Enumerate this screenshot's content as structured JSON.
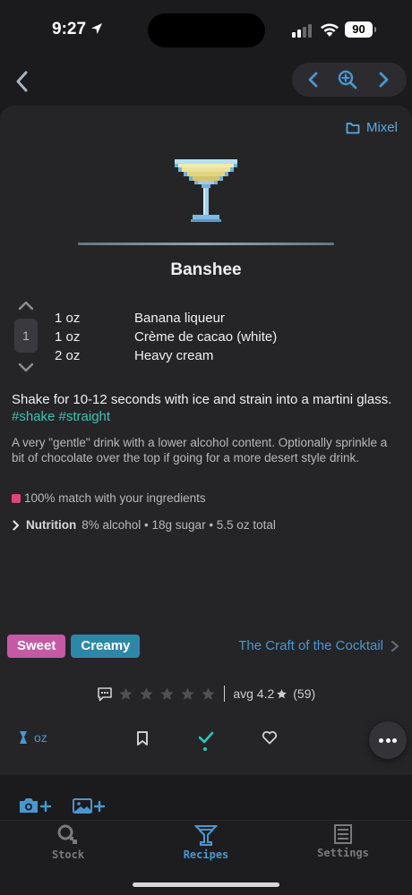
{
  "status": {
    "time": "9:27",
    "battery": "90"
  },
  "folder": {
    "label": "Mixel"
  },
  "drink": {
    "title": "Banshee",
    "serving_count": "1",
    "ingredients": [
      {
        "amount": "1 oz",
        "name": "Banana liqueur"
      },
      {
        "amount": "1 oz",
        "name": "Crème de cacao (white)"
      },
      {
        "amount": "2 oz",
        "name": "Heavy cream"
      }
    ],
    "instructions": "Shake for 10-12 seconds with ice and strain into a martini glass.",
    "instruction_tags": "#shake #straight",
    "description": "A very \"gentle\" drink with a lower alcohol content. Optionally sprinkle a bit of chocolate over the top if going for a more desert style drink.",
    "match_text": "100% match with your ingredients",
    "nutrition_label": "Nutrition",
    "nutrition_values": "8% alcohol • 18g sugar • 5.5 oz total",
    "flavor_tags": [
      "Sweet",
      "Creamy"
    ],
    "source": "The Craft of the Cocktail",
    "rating": {
      "user_stars": 0,
      "avg_text": "avg 4.2",
      "count_text": "(59)"
    },
    "unit_label": "oz"
  },
  "tabs": [
    {
      "label": "Stock",
      "icon": "magnifier-icon"
    },
    {
      "label": "Recipes",
      "icon": "martini-glass-icon"
    },
    {
      "label": "Settings",
      "icon": "list-icon"
    }
  ],
  "colors": {
    "accent": "#4a97cf",
    "teal": "#3ec3b4",
    "sweet": "#c45aa6",
    "creamy": "#2f87a8",
    "match": "#e0457c"
  }
}
